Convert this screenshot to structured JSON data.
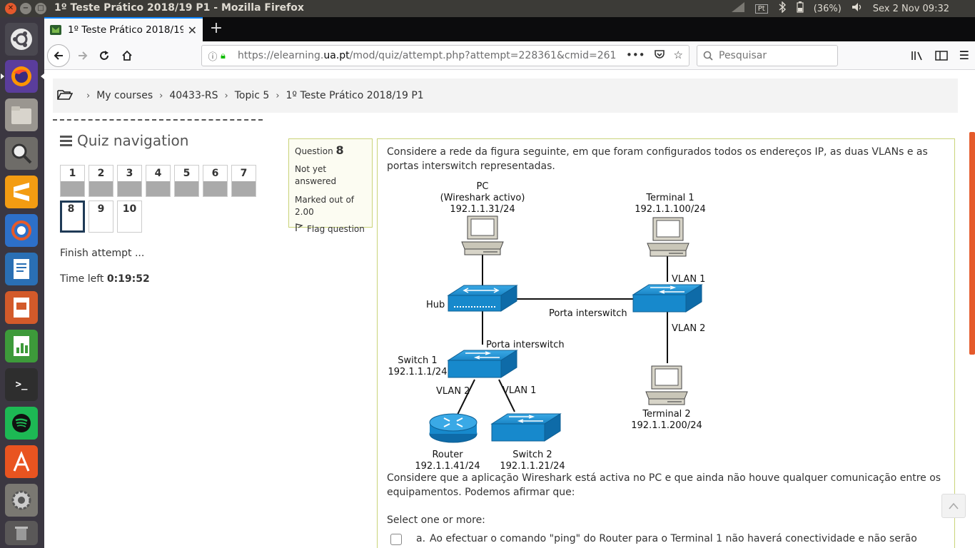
{
  "os": {
    "window_title": "1º Teste Prático 2018/19 P1 - Mozilla Firefox",
    "tray": {
      "pt_label": "Pt",
      "battery": "(36%)",
      "clock": "Sex  2 Nov 09:32"
    }
  },
  "browser": {
    "tab_title": "1º Teste Prático 2018/19 P1",
    "url_host_prefix": "https://elearning.",
    "url_host": "ua.pt",
    "url_path": "/mod/quiz/attempt.php?attempt=228361&cmid=261",
    "search_placeholder": "Pesquisar"
  },
  "breadcrumb": [
    "My courses",
    "40433-RS",
    "Topic 5",
    "1º Teste Prático 2018/19 P1"
  ],
  "quiz_nav": {
    "title": "Quiz navigation",
    "questions": [
      "1",
      "2",
      "3",
      "4",
      "5",
      "6",
      "7",
      "8",
      "9",
      "10"
    ],
    "finish": "Finish attempt ...",
    "time_label": "Time left",
    "time_value": "0:19:52"
  },
  "question_info": {
    "label": "Question",
    "number": "8",
    "state": "Not yet answered",
    "marked": "Marked out of 2.00",
    "flag": "Flag question"
  },
  "question": {
    "intro": "Considere a rede da figura seguinte, em que foram configurados todos os endereços IP, as duas VLANs e as portas interswitch representadas.",
    "followup": "Considere que a aplicação Wireshark está activa no PC e que ainda não houve qualquer comunicação entre os equipamentos. Podemos afirmar que:",
    "prompt": "Select one or more:",
    "options": [
      {
        "letter": "a.",
        "text": "Ao efectuar o comando \"ping\" do Router para o Terminal 1 não haverá conectividade e não serão capturados pacotes ARP no PC."
      }
    ]
  },
  "diagram": {
    "pc": [
      "PC",
      "(Wireshark activo)",
      "192.1.1.31/24"
    ],
    "terminal1": [
      "Terminal 1",
      "192.1.1.100/24"
    ],
    "terminal2": [
      "Terminal 2",
      "192.1.1.200/24"
    ],
    "hub": "Hub",
    "switch1": [
      "Switch 1",
      "192.1.1.1/24"
    ],
    "switch2": [
      "Switch 2",
      "192.1.1.21/24"
    ],
    "router": [
      "Router",
      "192.1.1.41/24"
    ],
    "interswitch_h": "Porta interswitch",
    "interswitch_v": "Porta interswitch",
    "vlan1_top": "VLAN 1",
    "vlan2_right": "VLAN 2",
    "vlan2_sw1": "VLAN 2",
    "vlan1_sw1": "VLAN 1"
  }
}
